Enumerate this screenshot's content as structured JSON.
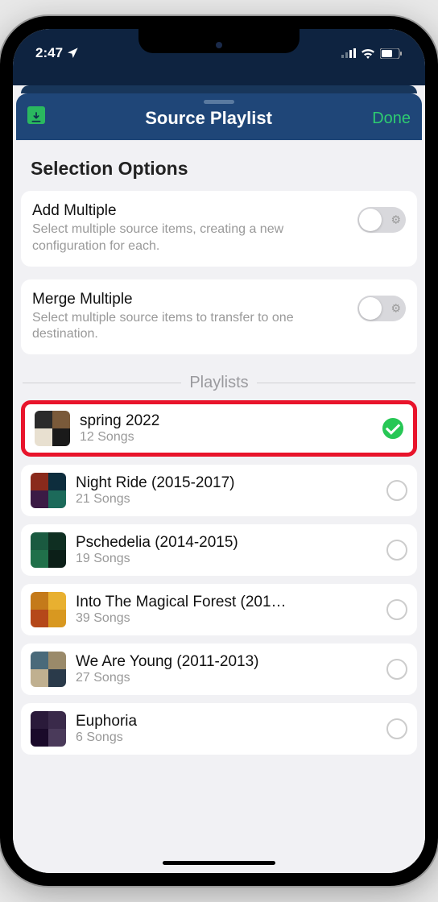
{
  "statusBar": {
    "time": "2:47"
  },
  "header": {
    "title": "Source Playlist",
    "done": "Done"
  },
  "selection": {
    "heading": "Selection Options",
    "options": [
      {
        "title": "Add Multiple",
        "desc": "Select multiple source items, creating a new configuration for each."
      },
      {
        "title": "Merge Multiple",
        "desc": "Select multiple source items to transfer to one destination."
      }
    ]
  },
  "playlistsLabel": "Playlists",
  "playlists": [
    {
      "title": "spring 2022",
      "sub": "12 Songs",
      "selected": true,
      "highlight": true,
      "art": [
        "#2b2b2b",
        "#7a5a3a",
        "#e8e0d0",
        "#1a1a1a"
      ]
    },
    {
      "title": "Night Ride (2015-2017)",
      "sub": "21 Songs",
      "selected": false,
      "highlight": false,
      "art": [
        "#8a2a1c",
        "#0d2d3d",
        "#3b1b45",
        "#1c6a5a"
      ]
    },
    {
      "title": "Pschedelia (2014-2015)",
      "sub": "19 Songs",
      "selected": false,
      "highlight": false,
      "art": [
        "#1a5a40",
        "#0f2f22",
        "#20704a",
        "#0c1f18"
      ]
    },
    {
      "title": "Into The Magical Forest (201…",
      "sub": "39 Songs",
      "selected": false,
      "highlight": false,
      "art": [
        "#c47a1a",
        "#e8b030",
        "#b5481a",
        "#d89820"
      ]
    },
    {
      "title": "We Are Young (2011-2013)",
      "sub": "27 Songs",
      "selected": false,
      "highlight": false,
      "art": [
        "#4a6a7a",
        "#9a8a6a",
        "#c0b090",
        "#2a3a4a"
      ]
    },
    {
      "title": "Euphoria",
      "sub": "6 Songs",
      "selected": false,
      "highlight": false,
      "art": [
        "#2a1a3a",
        "#3a2a4a",
        "#1a0a2a",
        "#4a3a5a"
      ]
    }
  ]
}
